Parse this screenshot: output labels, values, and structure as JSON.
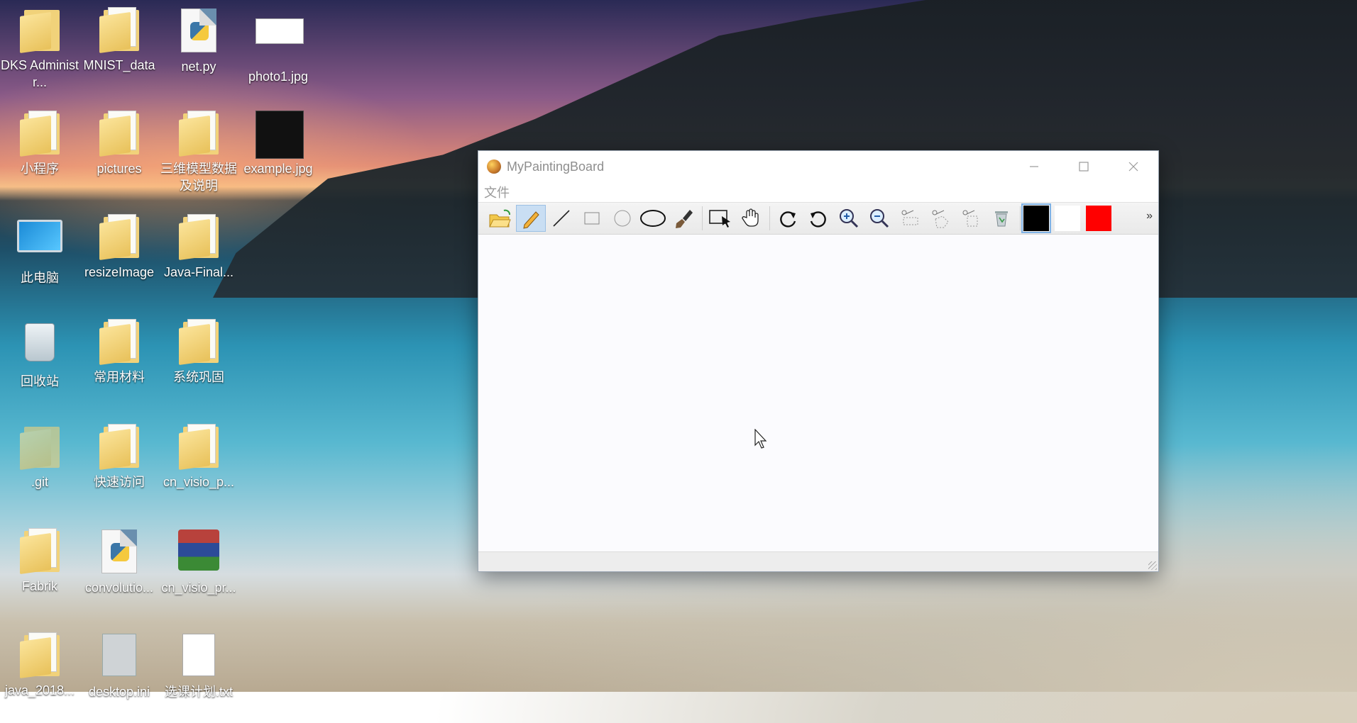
{
  "desktop": {
    "icons": [
      {
        "label": "DKS Administr...",
        "icon": "user-folder-icon"
      },
      {
        "label": "MNIST_data",
        "icon": "folder-icon"
      },
      {
        "label": "net.py",
        "icon": "python-file-icon"
      },
      {
        "label": "photo1.jpg",
        "icon": "image-file-icon"
      },
      {
        "label": "小程序",
        "icon": "folder-icon"
      },
      {
        "label": "pictures",
        "icon": "folder-icon"
      },
      {
        "label": "三维模型数据及说明",
        "icon": "folder-icon"
      },
      {
        "label": "example.jpg",
        "icon": "image-file-icon"
      },
      {
        "label": "此电脑",
        "icon": "computer-icon"
      },
      {
        "label": "resizeImage",
        "icon": "folder-icon"
      },
      {
        "label": "Java-Final...",
        "icon": "folder-icon"
      },
      {
        "label": "回收站",
        "icon": "recycle-bin-icon"
      },
      {
        "label": "常用材料",
        "icon": "folder-icon"
      },
      {
        "label": "系统巩固",
        "icon": "folder-icon"
      },
      {
        "label": ".git",
        "icon": "folder-icon"
      },
      {
        "label": "快速访问",
        "icon": "folder-icon"
      },
      {
        "label": "cn_visio_p...",
        "icon": "folder-icon"
      },
      {
        "label": "Fabrik",
        "icon": "folder-icon"
      },
      {
        "label": "convolutio...",
        "icon": "python-file-icon"
      },
      {
        "label": "cn_visio_pr...",
        "icon": "winrar-archive-icon"
      },
      {
        "label": "java_2018...",
        "icon": "folder-icon"
      },
      {
        "label": "desktop.ini",
        "icon": "settings-file-icon"
      },
      {
        "label": "选课计划.txt",
        "icon": "text-file-icon"
      }
    ]
  },
  "window": {
    "title": "MyPaintingBoard",
    "menu": [
      "文件"
    ],
    "toolbar": {
      "tools": [
        "open",
        "pencil",
        "line",
        "rectangle",
        "circle",
        "ellipse",
        "brush",
        "select",
        "hand",
        "redo",
        "undo",
        "zoom-in",
        "zoom-out",
        "cut",
        "cut-shape",
        "cut-region",
        "delete"
      ],
      "active_tool": "pencil",
      "colors": [
        "#000000",
        "#ffffff",
        "#ff0000"
      ],
      "overflow_label": "»"
    }
  }
}
